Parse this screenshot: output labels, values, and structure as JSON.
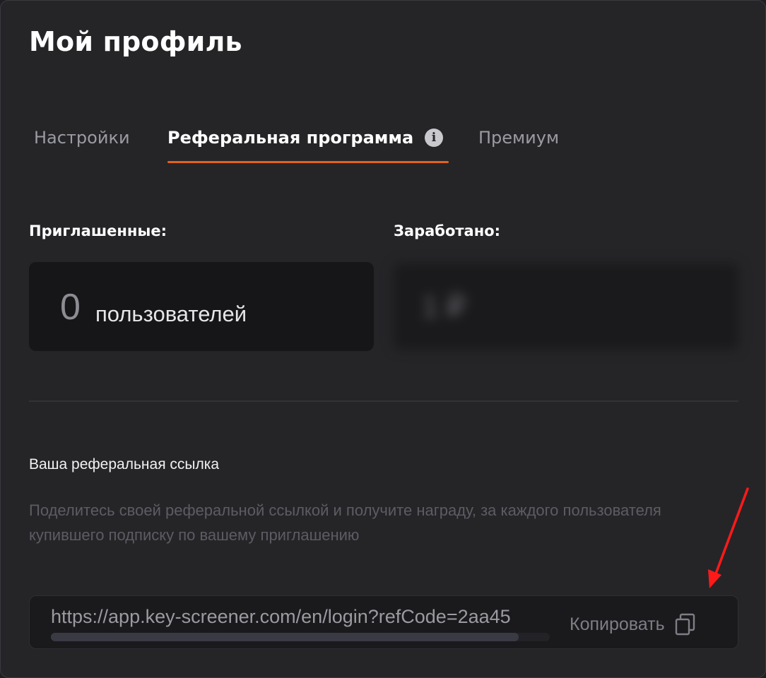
{
  "page": {
    "title": "Мой профиль"
  },
  "tabs": [
    {
      "label": "Настройки",
      "active": false
    },
    {
      "label": "Реферальная программа",
      "active": true
    },
    {
      "label": "Премиум",
      "active": false
    }
  ],
  "info_icon": {
    "glyph": "i",
    "icon": "info-icon"
  },
  "stats": {
    "invited_label": "Приглашенные:",
    "invited_count": "0",
    "invited_unit": "пользователей",
    "earned_label": "Заработано:",
    "earned_value": "1 ₽",
    "earned_blurred": true
  },
  "referral": {
    "title": "Ваша реферальная ссылка",
    "description": "Поделитесь своей реферальной ссылкой и получите награду, за каждого пользователя купившего подписку по вашему приглашению",
    "link": "https://app.key-screener.com/en/login?refCode=2aa45",
    "copy_label": "Копировать",
    "copy_icon": "copy-icon"
  },
  "colors": {
    "background": "#252528",
    "accent": "#e2621d",
    "annotation": "#ff1a1a"
  }
}
